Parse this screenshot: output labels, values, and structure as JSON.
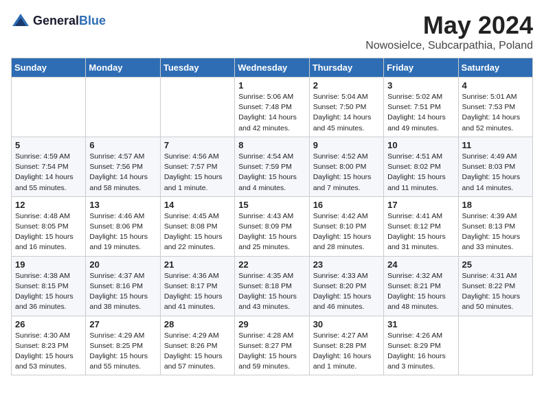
{
  "header": {
    "logo_general": "General",
    "logo_blue": "Blue",
    "month": "May 2024",
    "location": "Nowosielce, Subcarpathia, Poland"
  },
  "days_of_week": [
    "Sunday",
    "Monday",
    "Tuesday",
    "Wednesday",
    "Thursday",
    "Friday",
    "Saturday"
  ],
  "weeks": [
    [
      {
        "day": "",
        "info": ""
      },
      {
        "day": "",
        "info": ""
      },
      {
        "day": "",
        "info": ""
      },
      {
        "day": "1",
        "info": "Sunrise: 5:06 AM\nSunset: 7:48 PM\nDaylight: 14 hours\nand 42 minutes."
      },
      {
        "day": "2",
        "info": "Sunrise: 5:04 AM\nSunset: 7:50 PM\nDaylight: 14 hours\nand 45 minutes."
      },
      {
        "day": "3",
        "info": "Sunrise: 5:02 AM\nSunset: 7:51 PM\nDaylight: 14 hours\nand 49 minutes."
      },
      {
        "day": "4",
        "info": "Sunrise: 5:01 AM\nSunset: 7:53 PM\nDaylight: 14 hours\nand 52 minutes."
      }
    ],
    [
      {
        "day": "5",
        "info": "Sunrise: 4:59 AM\nSunset: 7:54 PM\nDaylight: 14 hours\nand 55 minutes."
      },
      {
        "day": "6",
        "info": "Sunrise: 4:57 AM\nSunset: 7:56 PM\nDaylight: 14 hours\nand 58 minutes."
      },
      {
        "day": "7",
        "info": "Sunrise: 4:56 AM\nSunset: 7:57 PM\nDaylight: 15 hours\nand 1 minute."
      },
      {
        "day": "8",
        "info": "Sunrise: 4:54 AM\nSunset: 7:59 PM\nDaylight: 15 hours\nand 4 minutes."
      },
      {
        "day": "9",
        "info": "Sunrise: 4:52 AM\nSunset: 8:00 PM\nDaylight: 15 hours\nand 7 minutes."
      },
      {
        "day": "10",
        "info": "Sunrise: 4:51 AM\nSunset: 8:02 PM\nDaylight: 15 hours\nand 11 minutes."
      },
      {
        "day": "11",
        "info": "Sunrise: 4:49 AM\nSunset: 8:03 PM\nDaylight: 15 hours\nand 14 minutes."
      }
    ],
    [
      {
        "day": "12",
        "info": "Sunrise: 4:48 AM\nSunset: 8:05 PM\nDaylight: 15 hours\nand 16 minutes."
      },
      {
        "day": "13",
        "info": "Sunrise: 4:46 AM\nSunset: 8:06 PM\nDaylight: 15 hours\nand 19 minutes."
      },
      {
        "day": "14",
        "info": "Sunrise: 4:45 AM\nSunset: 8:08 PM\nDaylight: 15 hours\nand 22 minutes."
      },
      {
        "day": "15",
        "info": "Sunrise: 4:43 AM\nSunset: 8:09 PM\nDaylight: 15 hours\nand 25 minutes."
      },
      {
        "day": "16",
        "info": "Sunrise: 4:42 AM\nSunset: 8:10 PM\nDaylight: 15 hours\nand 28 minutes."
      },
      {
        "day": "17",
        "info": "Sunrise: 4:41 AM\nSunset: 8:12 PM\nDaylight: 15 hours\nand 31 minutes."
      },
      {
        "day": "18",
        "info": "Sunrise: 4:39 AM\nSunset: 8:13 PM\nDaylight: 15 hours\nand 33 minutes."
      }
    ],
    [
      {
        "day": "19",
        "info": "Sunrise: 4:38 AM\nSunset: 8:15 PM\nDaylight: 15 hours\nand 36 minutes."
      },
      {
        "day": "20",
        "info": "Sunrise: 4:37 AM\nSunset: 8:16 PM\nDaylight: 15 hours\nand 38 minutes."
      },
      {
        "day": "21",
        "info": "Sunrise: 4:36 AM\nSunset: 8:17 PM\nDaylight: 15 hours\nand 41 minutes."
      },
      {
        "day": "22",
        "info": "Sunrise: 4:35 AM\nSunset: 8:18 PM\nDaylight: 15 hours\nand 43 minutes."
      },
      {
        "day": "23",
        "info": "Sunrise: 4:33 AM\nSunset: 8:20 PM\nDaylight: 15 hours\nand 46 minutes."
      },
      {
        "day": "24",
        "info": "Sunrise: 4:32 AM\nSunset: 8:21 PM\nDaylight: 15 hours\nand 48 minutes."
      },
      {
        "day": "25",
        "info": "Sunrise: 4:31 AM\nSunset: 8:22 PM\nDaylight: 15 hours\nand 50 minutes."
      }
    ],
    [
      {
        "day": "26",
        "info": "Sunrise: 4:30 AM\nSunset: 8:23 PM\nDaylight: 15 hours\nand 53 minutes."
      },
      {
        "day": "27",
        "info": "Sunrise: 4:29 AM\nSunset: 8:25 PM\nDaylight: 15 hours\nand 55 minutes."
      },
      {
        "day": "28",
        "info": "Sunrise: 4:29 AM\nSunset: 8:26 PM\nDaylight: 15 hours\nand 57 minutes."
      },
      {
        "day": "29",
        "info": "Sunrise: 4:28 AM\nSunset: 8:27 PM\nDaylight: 15 hours\nand 59 minutes."
      },
      {
        "day": "30",
        "info": "Sunrise: 4:27 AM\nSunset: 8:28 PM\nDaylight: 16 hours\nand 1 minute."
      },
      {
        "day": "31",
        "info": "Sunrise: 4:26 AM\nSunset: 8:29 PM\nDaylight: 16 hours\nand 3 minutes."
      },
      {
        "day": "",
        "info": ""
      }
    ]
  ]
}
